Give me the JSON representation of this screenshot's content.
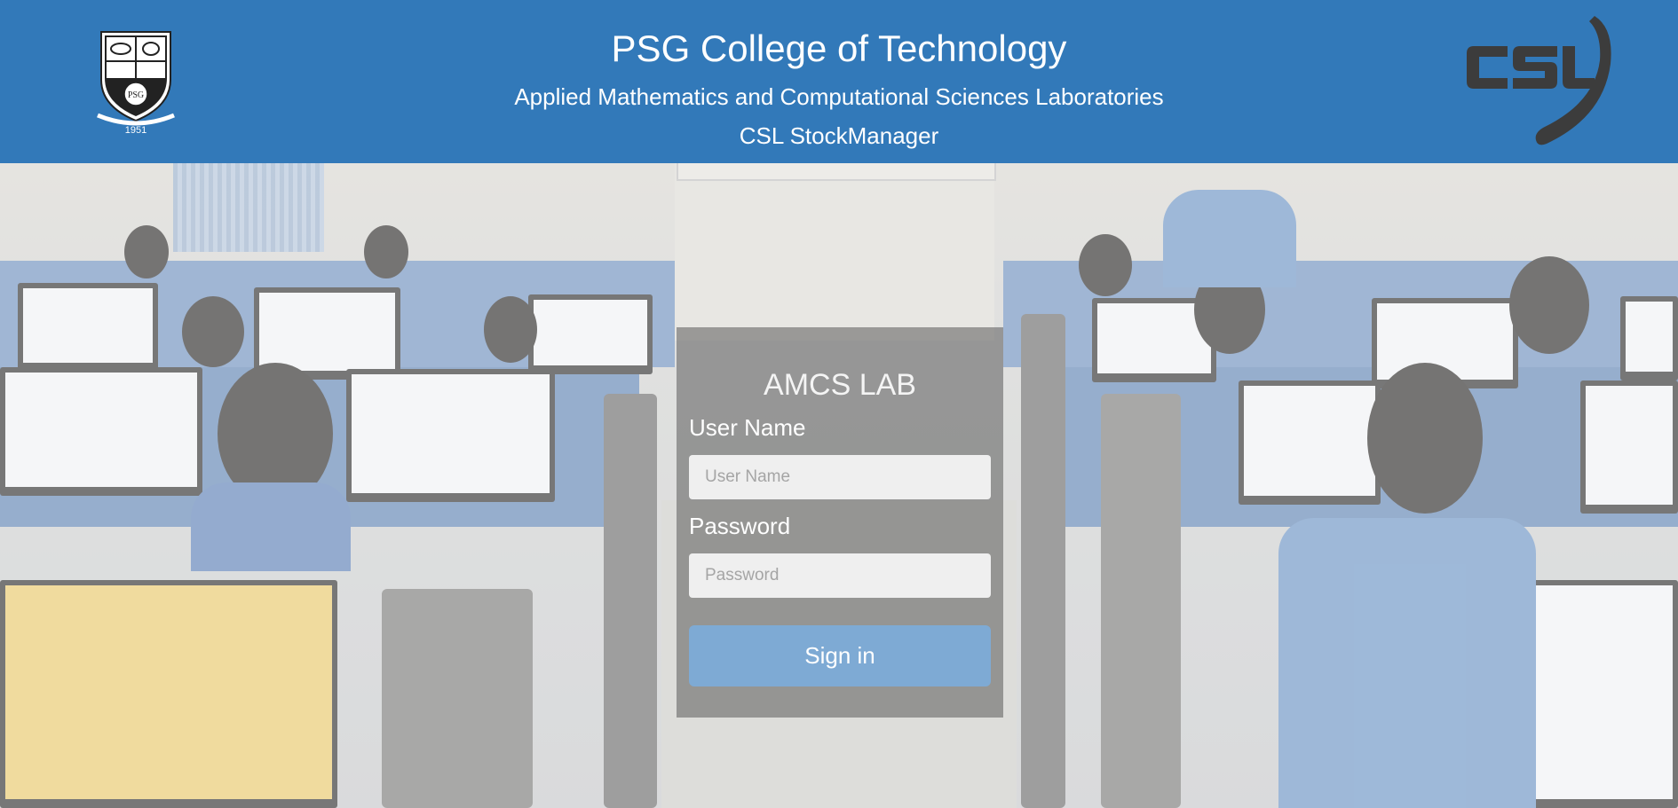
{
  "header": {
    "title": "PSG College of Technology",
    "subtitle": "Applied Mathematics and Computational Sciences Laboratories",
    "app_name": "CSL StockManager",
    "logo_left": {
      "icon": "college-crest-icon",
      "year": "1951",
      "motto": "PSG"
    },
    "logo_right": {
      "icon": "csl-logo-icon",
      "text": "CSL"
    },
    "background_color": "#3279b9"
  },
  "login": {
    "title": "AMCS LAB",
    "username_label": "User Name",
    "username_placeholder": "User Name",
    "username_value": "",
    "password_label": "Password",
    "password_placeholder": "Password",
    "password_value": "",
    "signin_label": "Sign in",
    "button_color": "#7eaad4"
  }
}
